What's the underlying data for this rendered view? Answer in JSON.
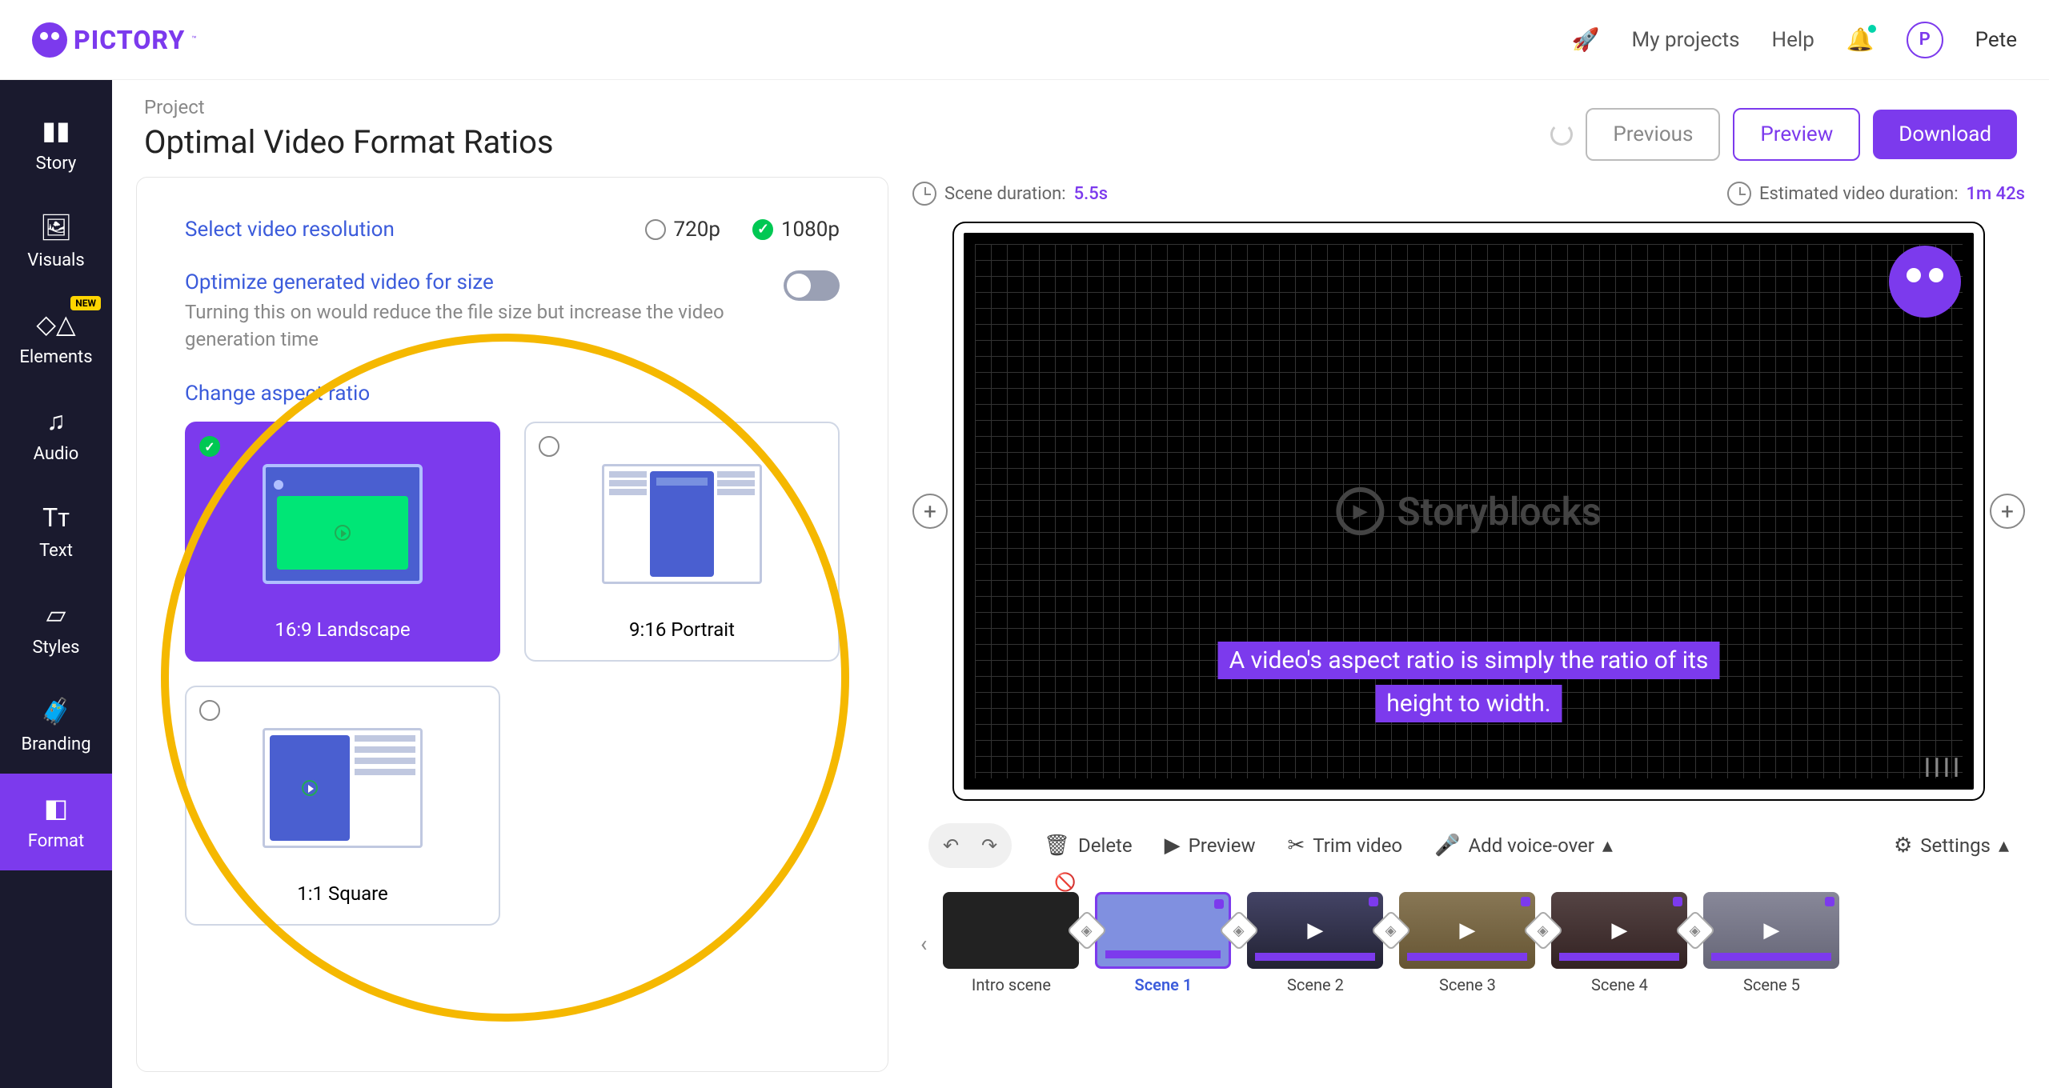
{
  "brand": {
    "name": "PICTORY",
    "tm": "™"
  },
  "topbar": {
    "my_projects": "My projects",
    "help": "Help",
    "user_initial": "P",
    "username": "Pete"
  },
  "sidebar": {
    "items": [
      {
        "label": "Story"
      },
      {
        "label": "Visuals"
      },
      {
        "label": "Elements",
        "badge": "NEW"
      },
      {
        "label": "Audio"
      },
      {
        "label": "Text"
      },
      {
        "label": "Styles"
      },
      {
        "label": "Branding"
      },
      {
        "label": "Format"
      }
    ]
  },
  "header": {
    "breadcrumb": "Project",
    "title": "Optimal Video Format Ratios",
    "previous": "Previous",
    "preview": "Preview",
    "download": "Download"
  },
  "format_panel": {
    "resolution_title": "Select video resolution",
    "res_720": "720p",
    "res_1080": "1080p",
    "optimize_title": "Optimize generated video for size",
    "optimize_desc": "Turning this on would reduce the file size but increase the video generation time",
    "aspect_title": "Change aspect ratio",
    "ratios": {
      "landscape": "16:9 Landscape",
      "portrait": "9:16 Portrait",
      "square": "1:1 Square"
    }
  },
  "preview": {
    "scene_duration_label": "Scene duration:",
    "scene_duration_value": "5.5s",
    "est_label": "Estimated video duration:",
    "est_value": "1m 42s",
    "watermark": "Storyblocks",
    "caption": "A video's aspect ratio is simply the ratio of its height to width."
  },
  "toolbar": {
    "delete": "Delete",
    "preview": "Preview",
    "trim": "Trim video",
    "voice": "Add voice-over",
    "settings": "Settings"
  },
  "scenes": [
    {
      "label": "Intro scene"
    },
    {
      "label": "Scene 1"
    },
    {
      "label": "Scene 2"
    },
    {
      "label": "Scene 3"
    },
    {
      "label": "Scene 4"
    },
    {
      "label": "Scene 5"
    }
  ]
}
